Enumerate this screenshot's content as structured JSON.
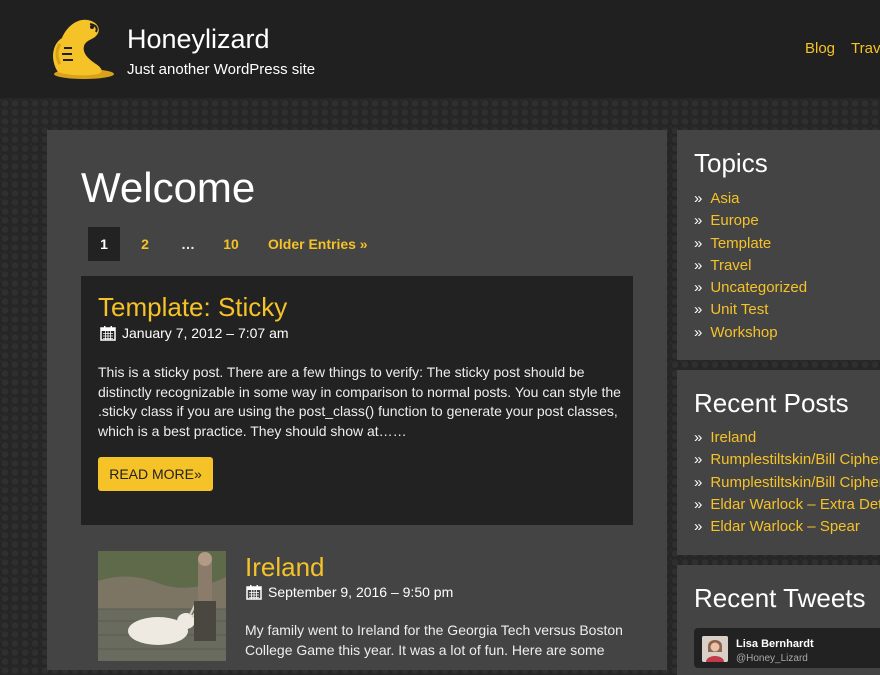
{
  "site": {
    "title": "Honeylizard",
    "description": "Just another WordPress site"
  },
  "nav": [
    "Blog",
    "Travel"
  ],
  "main": {
    "heading": "Welcome",
    "pagination": {
      "current": "1",
      "page2": "2",
      "dots": "…",
      "last": "10",
      "older": "Older Entries »"
    },
    "sticky_post": {
      "title": "Template: Sticky",
      "date": "January 7, 2012 – 7:07 am",
      "excerpt_lines": [
        "This is a sticky post. There are a few things to verify: The sticky post should be",
        "distinctly recognizable in some way in comparison to normal posts. You can style the",
        ".sticky class if you are using the post_class() function to generate your post classes,",
        "which is a best practice. They should show at……"
      ],
      "read_more": "READ MORE»"
    },
    "post2": {
      "title": "Ireland",
      "date": "September 9, 2016 – 9:50 pm",
      "excerpt_lines": [
        "My family went to Ireland for the Georgia Tech versus Boston",
        "College Game this year. It was a lot of fun. Here are some"
      ]
    }
  },
  "sidebar": {
    "topics": {
      "title": "Topics",
      "items": [
        "Asia",
        "Europe",
        "Template",
        "Travel",
        "Uncategorized",
        "Unit Test",
        "Workshop"
      ]
    },
    "recent_posts": {
      "title": "Recent Posts",
      "items": [
        "Ireland",
        "Rumplestiltskin/Bill Cipher",
        "Rumplestiltskin/Bill Cipher",
        "Eldar Warlock – Extra Detail",
        "Eldar Warlock – Spear"
      ]
    },
    "recent_tweets": {
      "title": "Recent Tweets",
      "tweet_name": "Lisa Bernhardt",
      "tweet_handle": "@Honey_Lizard"
    },
    "bullet": "»"
  },
  "colors": {
    "accent": "#f5c228",
    "header_bg": "#202020",
    "panel_bg": "#444444",
    "post_bg": "#222222"
  }
}
